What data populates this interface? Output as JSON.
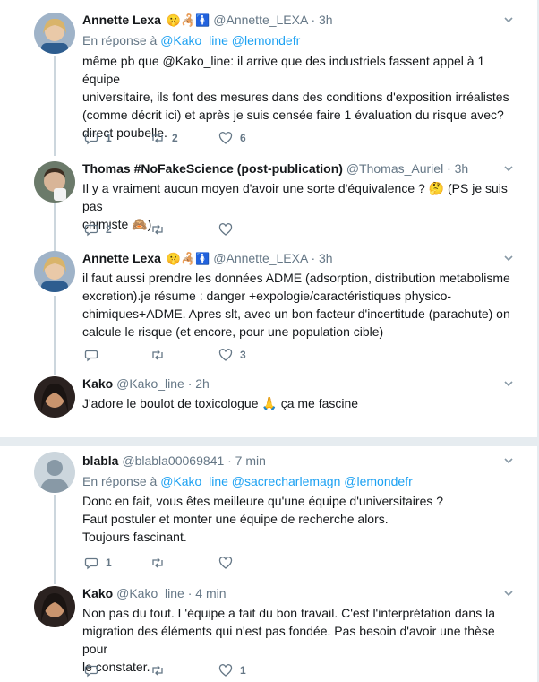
{
  "tweets": [
    {
      "name": "Annette Lexa",
      "badges": "🤫🦂🚺",
      "handle": "@Annette_LEXA",
      "time": "· 3h",
      "reply_prefix": "En réponse à",
      "reply_to": [
        "@Kako_line",
        "@lemondefr"
      ],
      "lines": [
        "même pb que @Kako_line: il arrive que des industriels fassent appel à 1 équipe",
        "universitaire, ils font des mesures dans des conditions d'exposition irréalistes",
        "(comme décrit ici) et après je suis censée faire 1 évaluation du risque  avec?",
        "direct poubelle."
      ],
      "reply_count": "1",
      "retweet_count": "2",
      "like_count": "6"
    },
    {
      "name": "Thomas #NoFakeScience (post-publication)",
      "handle": "@Thomas_Auriel",
      "time": "· 3h",
      "lines": [
        "Il y a vraiment aucun moyen d'avoir une sorte d'équivalence ? 🤔 (PS je suis pas",
        "chimiste 🙈)"
      ],
      "reply_count": "2",
      "retweet_count": "",
      "like_count": ""
    },
    {
      "name": "Annette Lexa",
      "badges": "🤫🦂🚺",
      "handle": "@Annette_LEXA",
      "time": "· 3h",
      "lines": [
        "il faut aussi prendre les données ADME (adsorption, distribution metabolisme",
        "excretion).je résume : danger +expologie/caractéristiques physico-",
        "chimiques+ADME. Apres slt,  avec un bon facteur d'incertitude (parachute) on",
        "calcule le risque (et encore, pour une population cible)"
      ],
      "reply_count": "",
      "retweet_count": "",
      "like_count": "3"
    },
    {
      "name": "Kako",
      "handle": "@Kako_line",
      "time": "· 2h",
      "lines": [
        "J'adore le boulot de toxicologue 🙏 ça me fascine"
      ],
      "reply_count": "",
      "retweet_count": "",
      "like_count": ""
    },
    {
      "name": "blabla",
      "handle": "@blabla00069841",
      "time": "· 7 min",
      "reply_prefix": "En réponse à",
      "reply_to": [
        "@Kako_line",
        "@sacrecharlemagn",
        "@lemondefr"
      ],
      "lines": [
        "Donc en fait, vous êtes meilleure qu'une équipe d'universitaires ?",
        "Faut postuler et monter une équipe de recherche alors.",
        "Toujours fascinant."
      ],
      "reply_count": "1",
      "retweet_count": "",
      "like_count": ""
    },
    {
      "name": "Kako",
      "handle": "@Kako_line",
      "time": "· 4 min",
      "lines": [
        "Non pas du tout. L'équipe a fait du bon travail. C'est l'interprétation dans la",
        "migration des éléments qui n'est pas fondée. Pas besoin d'avoir une thèse pour",
        "le constater."
      ],
      "reply_count": "",
      "retweet_count": "",
      "like_count": "1"
    }
  ],
  "icons": {
    "reply": "reply-icon",
    "retweet": "retweet-icon",
    "like": "heart-icon",
    "menu": "chevron-down-icon"
  },
  "colors": {
    "link": "#1da1f2",
    "muted": "#657786",
    "divider": "#e6ecf0"
  }
}
